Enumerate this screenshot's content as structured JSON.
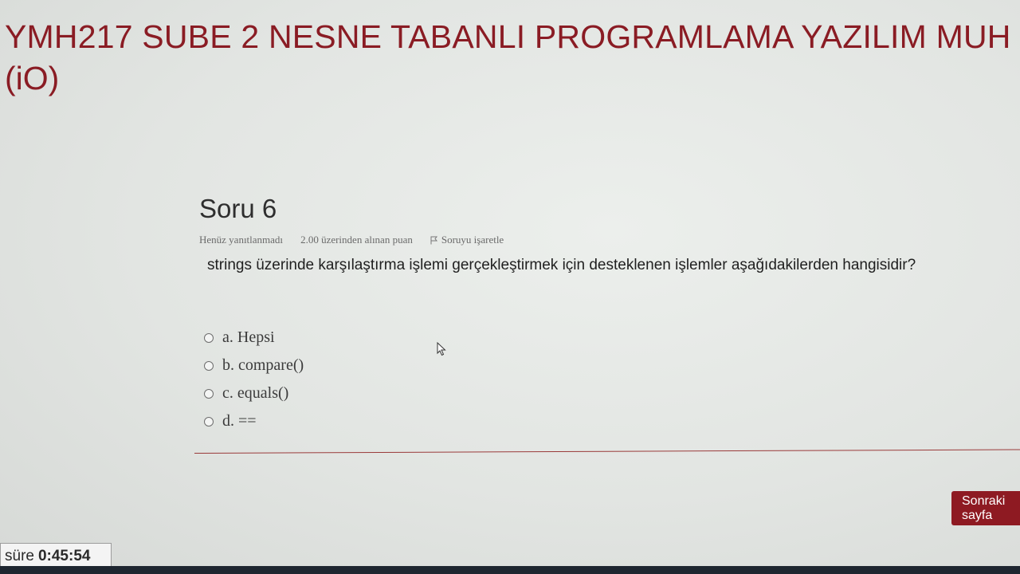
{
  "course": {
    "title": "YMH217 SUBE 2 NESNE TABANLI PROGRAMLAMA YAZILIM MUH",
    "subtitle": "(iO)"
  },
  "question": {
    "number_label": "Soru 6",
    "status": "Henüz yanıtlanmadı",
    "points": "2.00 üzerinden alınan puan",
    "flag_label": "Soruyu işaretle",
    "text": "strings üzerinde karşılaştırma işlemi gerçekleştirmek için desteklenen işlemler aşağıdakilerden hangisidir?",
    "answers": [
      {
        "label": "a. Hepsi"
      },
      {
        "label": "b. compare()"
      },
      {
        "label": "c. equals()"
      },
      {
        "label": "d. =="
      }
    ]
  },
  "navigation": {
    "next_label": "Sonraki sayfa"
  },
  "timer": {
    "label": "süre",
    "value": "0:45:54"
  },
  "colors": {
    "accent": "#8e1a22",
    "title": "#8a1c24"
  }
}
